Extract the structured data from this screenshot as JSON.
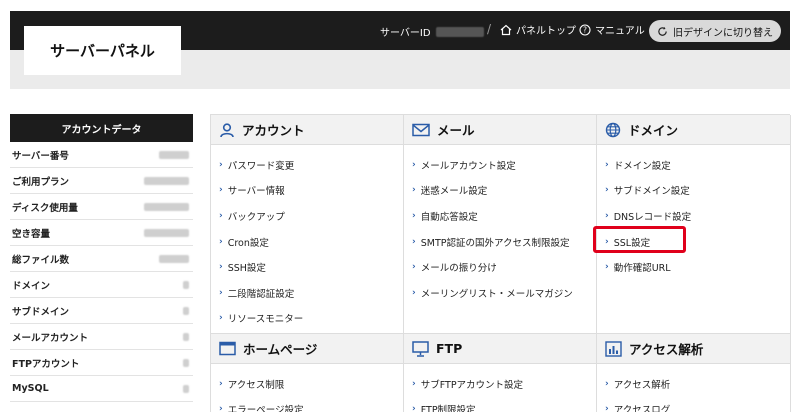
{
  "header": {
    "brand": "サーバーパネル",
    "server_id_label": "サーバーID",
    "separator": "/",
    "panel_top": "パネルトップ",
    "manual": "マニュアル",
    "old_design": "旧デザインに切り替え"
  },
  "sidebar": {
    "title": "アカウントデータ",
    "rows": [
      {
        "label": "サーバー番号"
      },
      {
        "label": "ご利用プラン"
      },
      {
        "label": "ディスク使用量"
      },
      {
        "label": "空き容量"
      },
      {
        "label": "総ファイル数"
      },
      {
        "label": "ドメイン"
      },
      {
        "label": "サブドメイン"
      },
      {
        "label": "メールアカウント"
      },
      {
        "label": "FTPアカウント"
      },
      {
        "label": "MySQL"
      }
    ]
  },
  "sections": {
    "account": {
      "title": "アカウント",
      "items": [
        "パスワード変更",
        "サーバー情報",
        "バックアップ",
        "Cron設定",
        "SSH設定",
        "二段階認証設定",
        "リソースモニター"
      ]
    },
    "mail": {
      "title": "メール",
      "items": [
        "メールアカウント設定",
        "迷惑メール設定",
        "自動応答設定",
        "SMTP認証の国外アクセス制限設定",
        "メールの振り分け",
        "メーリングリスト・メールマガジン"
      ]
    },
    "domain": {
      "title": "ドメイン",
      "items": [
        "ドメイン設定",
        "サブドメイン設定",
        "DNSレコード設定",
        "SSL設定",
        "動作確認URL"
      ]
    },
    "homepage": {
      "title": "ホームページ",
      "items": [
        "アクセス制限",
        "エラーページ設定"
      ]
    },
    "ftp": {
      "title": "FTP",
      "items": [
        "サブFTPアカウント設定",
        "FTP制限設定"
      ]
    },
    "analytics": {
      "title": "アクセス解析",
      "items": [
        "アクセス解析",
        "アクセスログ"
      ]
    }
  },
  "colors": {
    "topbar": "#1c1c1c",
    "accent_blue": "#2a5ca8",
    "highlight_red": "#e0001b"
  }
}
